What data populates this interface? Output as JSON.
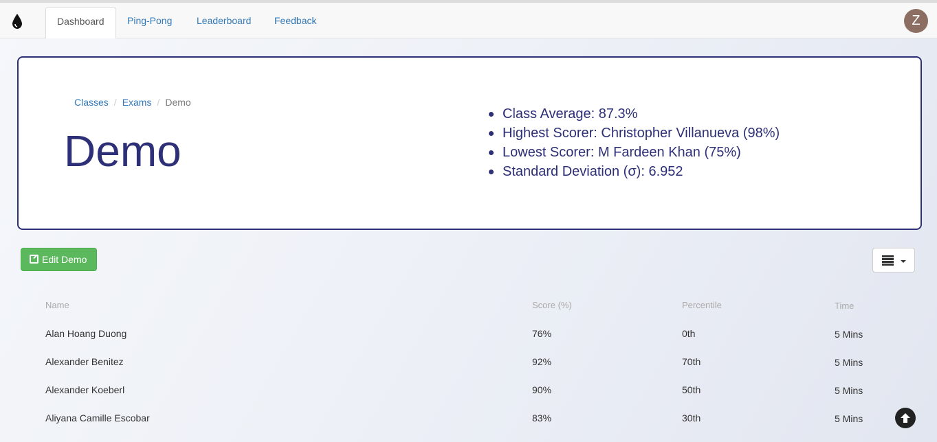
{
  "nav": {
    "tabs": [
      {
        "label": "Dashboard"
      },
      {
        "label": "Ping-Pong"
      },
      {
        "label": "Leaderboard"
      },
      {
        "label": "Feedback"
      }
    ],
    "avatar_initial": "Z"
  },
  "hero": {
    "breadcrumb": [
      "Classes",
      "Exams",
      "Demo"
    ],
    "title": "Demo",
    "stats": [
      "Class Average: 87.3%",
      "Highest Scorer: Christopher Villanueva (98%)",
      "Lowest Scorer: M Fardeen Khan (75%)",
      "Standard Deviation (σ): 6.952"
    ]
  },
  "toolbar": {
    "edit_label": "Edit Demo",
    "edit_icon": "edit-icon",
    "columns_icon": "list-icon"
  },
  "table": {
    "headers": [
      "Name",
      "Score (%)",
      "Percentile",
      "Time"
    ],
    "rows": [
      [
        "Alan Hoang Duong",
        "76%",
        "0th",
        "5 Mins"
      ],
      [
        "Alexander Benitez",
        "92%",
        "70th",
        "5 Mins"
      ],
      [
        "Alexander Koeberl",
        "90%",
        "50th",
        "5 Mins"
      ],
      [
        "Aliyana Camille Escobar",
        "83%",
        "30th",
        "5 Mins"
      ]
    ]
  },
  "colors": {
    "accent": "#2e3077",
    "link": "#337ab7",
    "success": "#5cb85c"
  }
}
